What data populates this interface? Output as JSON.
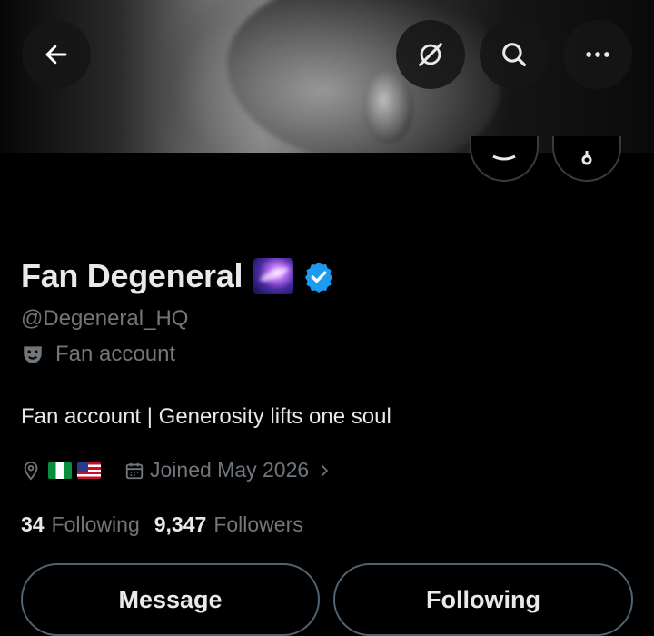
{
  "profile": {
    "display_name": "Fan Degeneral",
    "handle": "@Degeneral_HQ",
    "category": "Fan account",
    "bio": "Fan account | Generosity lifts one soul",
    "joined": "Joined May 2026",
    "following_count": "34",
    "following_label": "Following",
    "followers_count": "9,347",
    "followers_label": "Followers",
    "verified_color": "#1d9bf0"
  },
  "actions": {
    "message_label": "Message",
    "following_button_label": "Following"
  },
  "icons": {
    "back": "arrow-left-icon",
    "grok": "grok-icon",
    "search": "search-icon",
    "more": "more-icon"
  }
}
